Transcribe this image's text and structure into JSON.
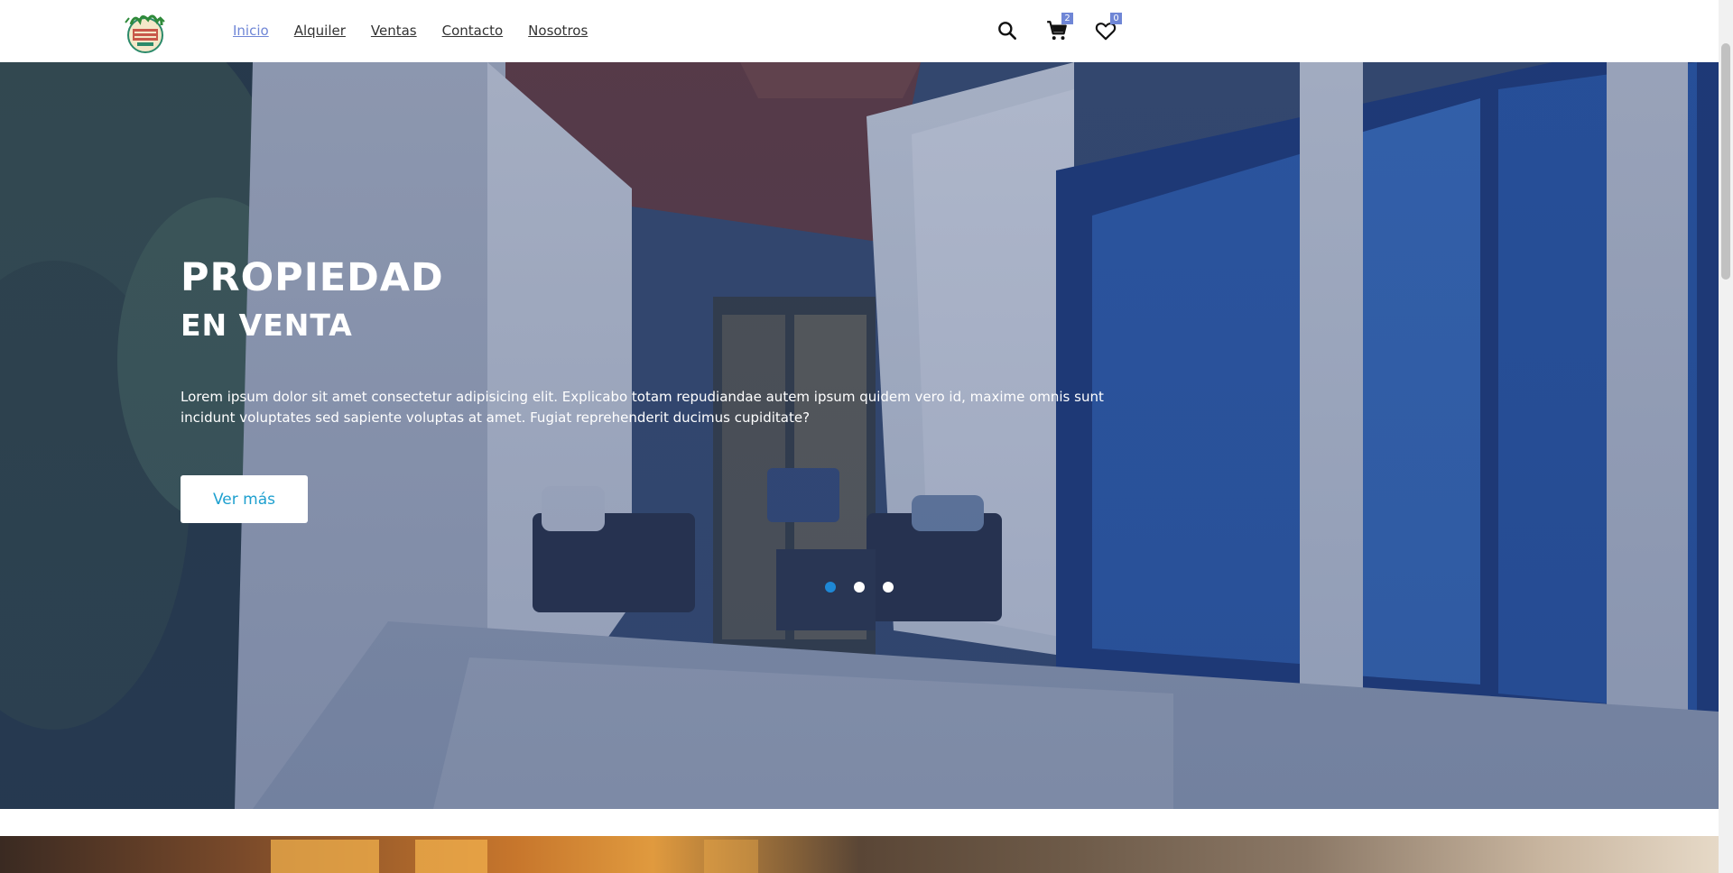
{
  "header": {
    "logo_name": "palm-logo",
    "nav": [
      "Inicio",
      "Alquiler",
      "Ventas",
      "Contacto",
      "Nosotros"
    ],
    "active_nav": "Inicio",
    "cart_count": "2",
    "favorites_count": "0"
  },
  "hero": {
    "title": "PROPIEDAD",
    "subtitle": "EN VENTA",
    "text": "Lorem ipsum dolor sit amet consectetur adipisicing elit. Explicabo totam repudiandae autem ipsum quidem vero id, maxime omnis sunt incidunt voluptates sed sapiente voluptas at amet. Fugiat reprehenderit ducimus cupiditate?",
    "button_label": "Ver más",
    "slides": 3,
    "active_slide": 1
  },
  "colors": {
    "accent": "#6f86d6",
    "button_text": "#1ea0cf",
    "active_dot": "#1e88d6"
  },
  "icons": [
    "search-icon",
    "cart-icon",
    "heart-icon"
  ]
}
